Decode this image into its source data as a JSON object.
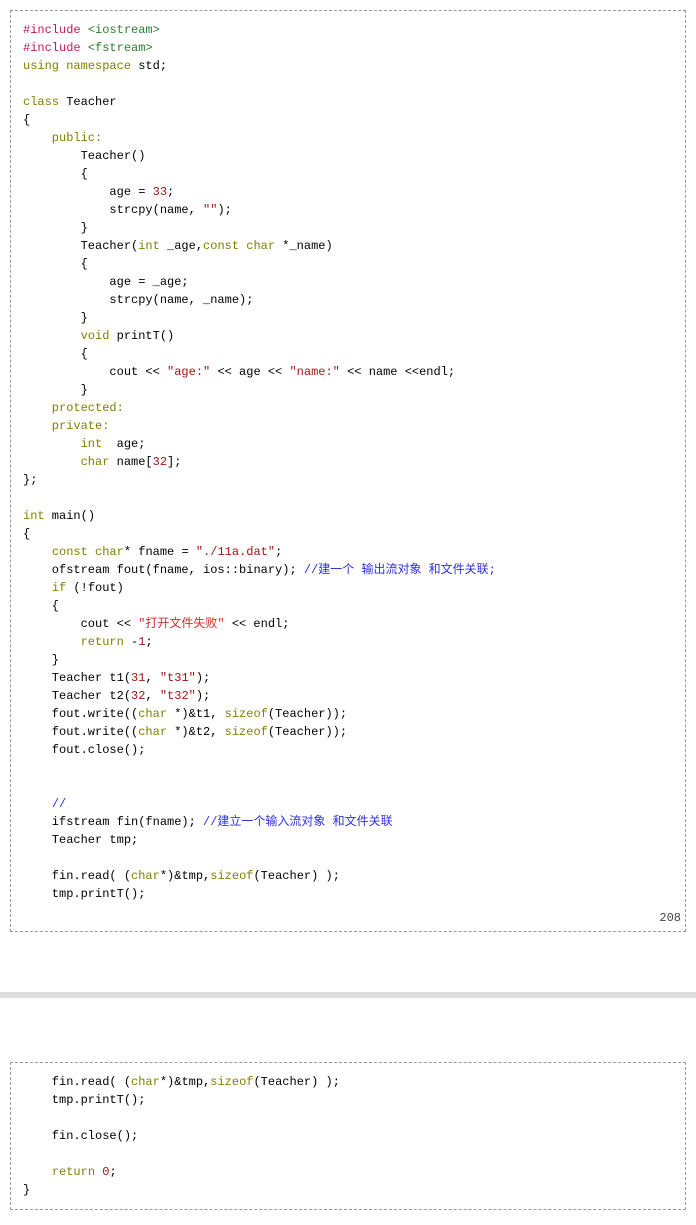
{
  "pageNumber": "208",
  "block1": {
    "l01a": "#include",
    "l01b": "<iostream>",
    "l02a": "#include",
    "l02b": "<fstream>",
    "l03a": "using",
    "l03b": "namespace",
    "l03c": "std;",
    "l04": "",
    "l05a": "class",
    "l05b": "Teacher",
    "l06": "{",
    "l07": "    public:",
    "l08": "        Teacher()",
    "l09": "        {",
    "l10a": "            age = ",
    "l10b": "33",
    "l10c": ";",
    "l11a": "            strcpy(name, ",
    "l11b": "\"\"",
    "l11c": ");",
    "l12": "        }",
    "l13a": "        Teacher(",
    "l13b": "int",
    "l13c": " _age,",
    "l13d": "const",
    "l13e": "char",
    "l13f": " *_name)",
    "l14": "        {",
    "l15": "            age = _age;",
    "l16": "            strcpy(name, _name);",
    "l17": "        }",
    "l18a": "        ",
    "l18b": "void",
    "l18c": " printT()",
    "l19": "        {",
    "l20a": "            cout << ",
    "l20b": "\"age:\"",
    "l20c": " << age << ",
    "l20d": "\"name:\"",
    "l20e": " << name <<endl;",
    "l21": "        }",
    "l22": "    protected:",
    "l23": "    private:",
    "l24a": "        ",
    "l24b": "int",
    "l24c": "  age;",
    "l25a": "        ",
    "l25b": "char",
    "l25c": " name[",
    "l25d": "32",
    "l25e": "];",
    "l26": "};",
    "l27": "",
    "l28a": "int",
    "l28b": " main()",
    "l29": "{",
    "l30a": "    ",
    "l30b": "const",
    "l30c": "char",
    "l30d": "* fname = ",
    "l30e": "\"./11a.dat\"",
    "l30f": ";",
    "l31a": "    ofstream fout(fname, ios::binary); ",
    "l31b": "//建一个 输出流对象 和文件关联;",
    "l32a": "    ",
    "l32b": "if",
    "l32c": " (!fout)",
    "l33": "    {",
    "l34a": "        cout << ",
    "l34b": "\"打开文件失败\"",
    "l34c": " << endl;",
    "l35a": "        ",
    "l35b": "return",
    "l35c": " -",
    "l35d": "1",
    "l35e": ";",
    "l36": "    }",
    "l37a": "    Teacher t1(",
    "l37b": "31",
    "l37c": ", ",
    "l37d": "\"t31\"",
    "l37e": ");",
    "l38a": "    Teacher t2(",
    "l38b": "32",
    "l38c": ", ",
    "l38d": "\"t32\"",
    "l38e": ");",
    "l39a": "    fout.write((",
    "l39b": "char",
    "l39c": " *)&t1, ",
    "l39d": "sizeof",
    "l39e": "(Teacher));",
    "l40a": "    fout.write((",
    "l40b": "char",
    "l40c": " *)&t2, ",
    "l40d": "sizeof",
    "l40e": "(Teacher));",
    "l41": "    fout.close();",
    "l42": "",
    "l43": "",
    "l44a": "    ",
    "l44b": "//",
    "l45a": "    ifstream fin(fname); ",
    "l45b": "//建立一个输入流对象 和文件关联",
    "l46": "    Teacher tmp;",
    "l47": "",
    "l48a": "    fin.read( (",
    "l48b": "char",
    "l48c": "*)&tmp,",
    "l48d": "sizeof",
    "l48e": "(Teacher) );",
    "l49": "    tmp.printT();",
    "l50": ""
  },
  "block2": {
    "l01a": "    fin.read( (",
    "l01b": "char",
    "l01c": "*)&tmp,",
    "l01d": "sizeof",
    "l01e": "(Teacher) );",
    "l02": "    tmp.printT();",
    "l03": "",
    "l04": "    fin.close();",
    "l05": "",
    "l06a": "    ",
    "l06b": "return",
    "l06c": " ",
    "l06d": "0",
    "l06e": ";",
    "l07": "}"
  }
}
